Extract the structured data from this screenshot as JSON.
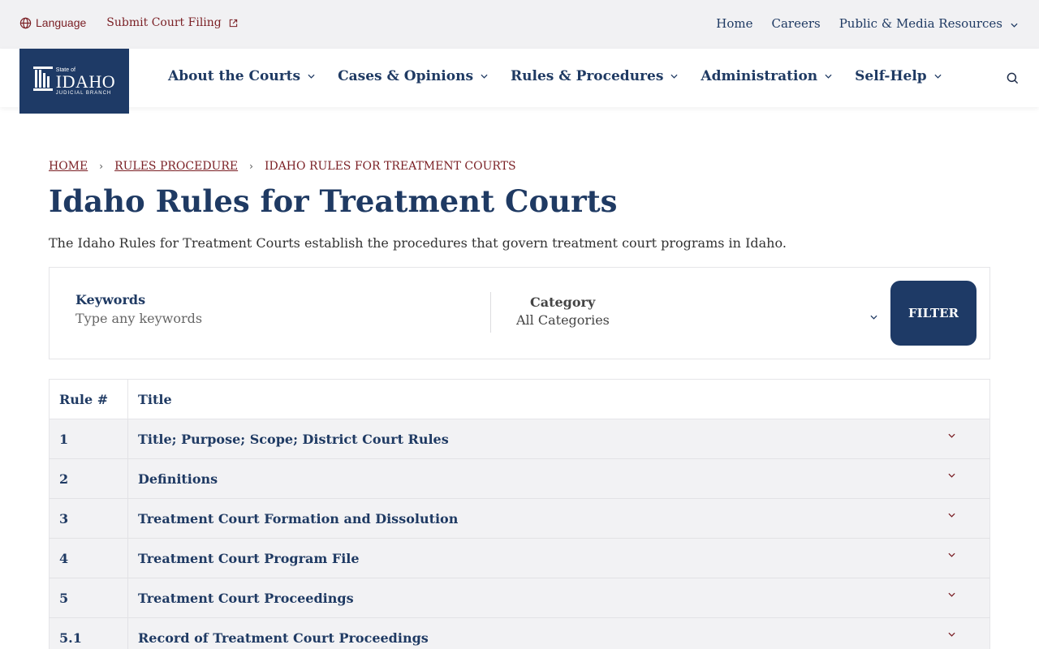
{
  "utility": {
    "language_label": "Language",
    "submit_label": "Submit Court Filing",
    "links": [
      "Home",
      "Careers",
      "Public & Media Resources"
    ]
  },
  "logo": {
    "state": "State of",
    "name": "IDAHO",
    "branch": "JUDICIAL BRANCH"
  },
  "nav": {
    "items": [
      "About the Courts",
      "Cases & Opinions",
      "Rules & Procedures",
      "Administration",
      "Self-Help"
    ]
  },
  "breadcrumb": {
    "home": "HOME",
    "section": "RULES PROCEDURE",
    "current": "IDAHO RULES FOR TREATMENT COURTS"
  },
  "page": {
    "title": "Idaho Rules for Treatment Courts",
    "intro": "The Idaho Rules for Treatment Courts establish the procedures that govern treatment court programs in Idaho."
  },
  "filter": {
    "keywords_label": "Keywords",
    "keywords_placeholder": "Type any keywords",
    "category_label": "Category",
    "category_value": "All Categories",
    "button_label": "FILTER"
  },
  "table": {
    "headers": [
      "Rule #",
      "Title"
    ],
    "rows": [
      {
        "num": "1",
        "title": "Title; Purpose; Scope; District Court Rules"
      },
      {
        "num": "2",
        "title": "Definitions"
      },
      {
        "num": "3",
        "title": "Treatment Court Formation and Dissolution"
      },
      {
        "num": "4",
        "title": "Treatment Court Program File"
      },
      {
        "num": "5",
        "title": "Treatment Court Proceedings"
      },
      {
        "num": "5.1",
        "title": "Record of Treatment Court Proceedings"
      }
    ]
  },
  "colors": {
    "navy": "#1e3a66",
    "maroon": "#7a1f24",
    "row_bg": "#f2f2f4"
  }
}
